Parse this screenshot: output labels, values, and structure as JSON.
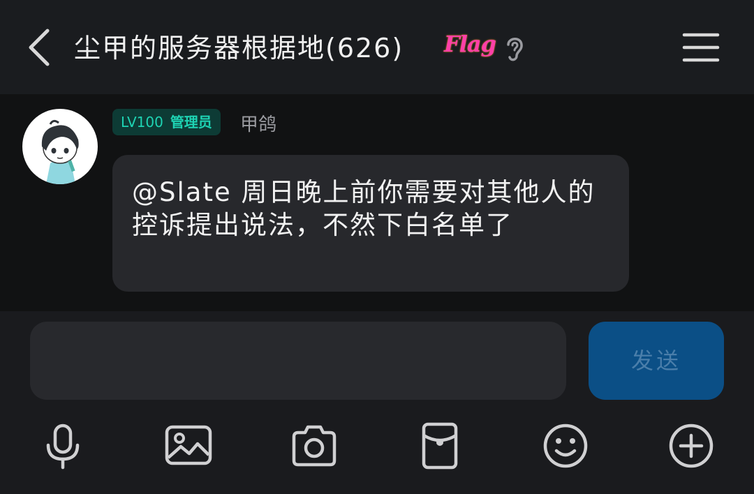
{
  "header": {
    "title": "尘甲的服务器根据地(626)",
    "flag_text": "Flag",
    "back_icon": "chevron-left-icon",
    "ear_icon": "ear-icon",
    "menu_icon": "hamburger-menu-icon"
  },
  "message": {
    "level": "LV100",
    "role": "管理员",
    "sender": "甲鸽",
    "text": "@Slate 周日晚上前你需要对其他人的控诉提出说法，不然下白名单了"
  },
  "composer": {
    "input_value": "",
    "send_label": "发送"
  },
  "toolbar": {
    "icons": [
      "microphone-icon",
      "image-icon",
      "camera-icon",
      "red-packet-icon",
      "emoji-icon",
      "plus-icon"
    ]
  },
  "colors": {
    "header_bg": "#1a1c1f",
    "chat_bg": "#111213",
    "bubble_bg": "#27282c",
    "badge_bg": "#0d3b35",
    "badge_text": "#1ed3b3",
    "send_bg": "#0b4f86"
  }
}
